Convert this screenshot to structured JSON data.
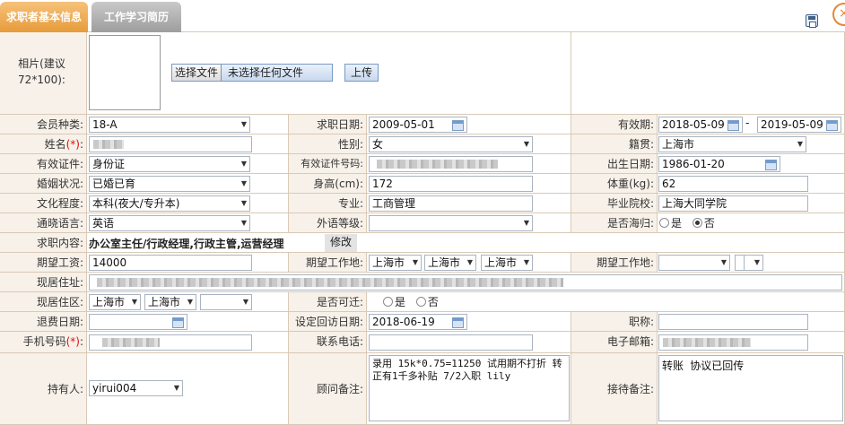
{
  "tabs": [
    "求职者基本信息",
    "工作学习简历"
  ],
  "photo": {
    "label": "相片(建议72*100):",
    "choose": "选择文件",
    "no_file": "未选择任何文件",
    "upload": "上传"
  },
  "rows": {
    "member_type": {
      "label": "会员种类:",
      "value": "18-A"
    },
    "apply_date": {
      "label": "求职日期:",
      "value": "2009-05-01"
    },
    "valid_period": {
      "label": "有效期:",
      "from": "2018-05-09",
      "sep": "-",
      "to": "2019-05-09"
    },
    "name": {
      "label": "姓名",
      "req": "(*)",
      "colon": ":"
    },
    "gender": {
      "label": "性别:",
      "value": "女"
    },
    "native": {
      "label": "籍贯:",
      "value": "上海市"
    },
    "id_type": {
      "label": "有效证件:",
      "value": "身份证"
    },
    "id_no": {
      "label": "有效证件号码:"
    },
    "birth": {
      "label": "出生日期:",
      "value": "1986-01-20"
    },
    "marital": {
      "label": "婚姻状况:",
      "value": "已婚已育"
    },
    "height": {
      "label": "身高(cm):",
      "value": "172"
    },
    "weight": {
      "label": "体重(kg):",
      "value": "62"
    },
    "education": {
      "label": "文化程度:",
      "value": "本科(夜大/专升本)"
    },
    "major": {
      "label": "专业:",
      "value": "工商管理"
    },
    "school": {
      "label": "毕业院校:",
      "value": "上海大同学院"
    },
    "language": {
      "label": "通晓语言:",
      "value": "英语"
    },
    "foreign_level": {
      "label": "外语等级:",
      "value": ""
    },
    "overseas": {
      "label": "是否海归:",
      "yes": "是",
      "no": "否"
    },
    "job_content": {
      "label": "求职内容:",
      "value": "办公室主任/行政经理,行政主管,运营经理",
      "edit": "修改"
    },
    "salary": {
      "label": "期望工资:",
      "value": "14000"
    },
    "expect_place": {
      "label": "期望工作地:",
      "p1": "上海市",
      "p2": "上海市",
      "p3": "上海市"
    },
    "expect_place2": {
      "label": "期望工作地:"
    },
    "address": {
      "label": "现居住址:"
    },
    "area": {
      "label": "现居住区:",
      "a1": "上海市",
      "a2": "上海市"
    },
    "migrate": {
      "label": "是否可迁:",
      "yes": "是",
      "no": "否"
    },
    "refund_date": {
      "label": "退费日期:"
    },
    "visit_date": {
      "label": "设定回访日期:",
      "value": "2018-06-19"
    },
    "title": {
      "label": "职称:"
    },
    "mobile": {
      "label": "手机号码",
      "req": "(*)",
      "colon": ":"
    },
    "phone": {
      "label": "联系电话:"
    },
    "email": {
      "label": "电子邮箱:"
    },
    "holder": {
      "label": "持有人:",
      "value": "yirui004"
    },
    "consult_note": {
      "label": "顾问备注:",
      "value": "录用 15k*0.75=11250 试用期不打折 转正有1千多补贴 7/2入职 lily"
    },
    "reception_note": {
      "label": "接待备注:",
      "value": "转账 协议已回传"
    }
  }
}
